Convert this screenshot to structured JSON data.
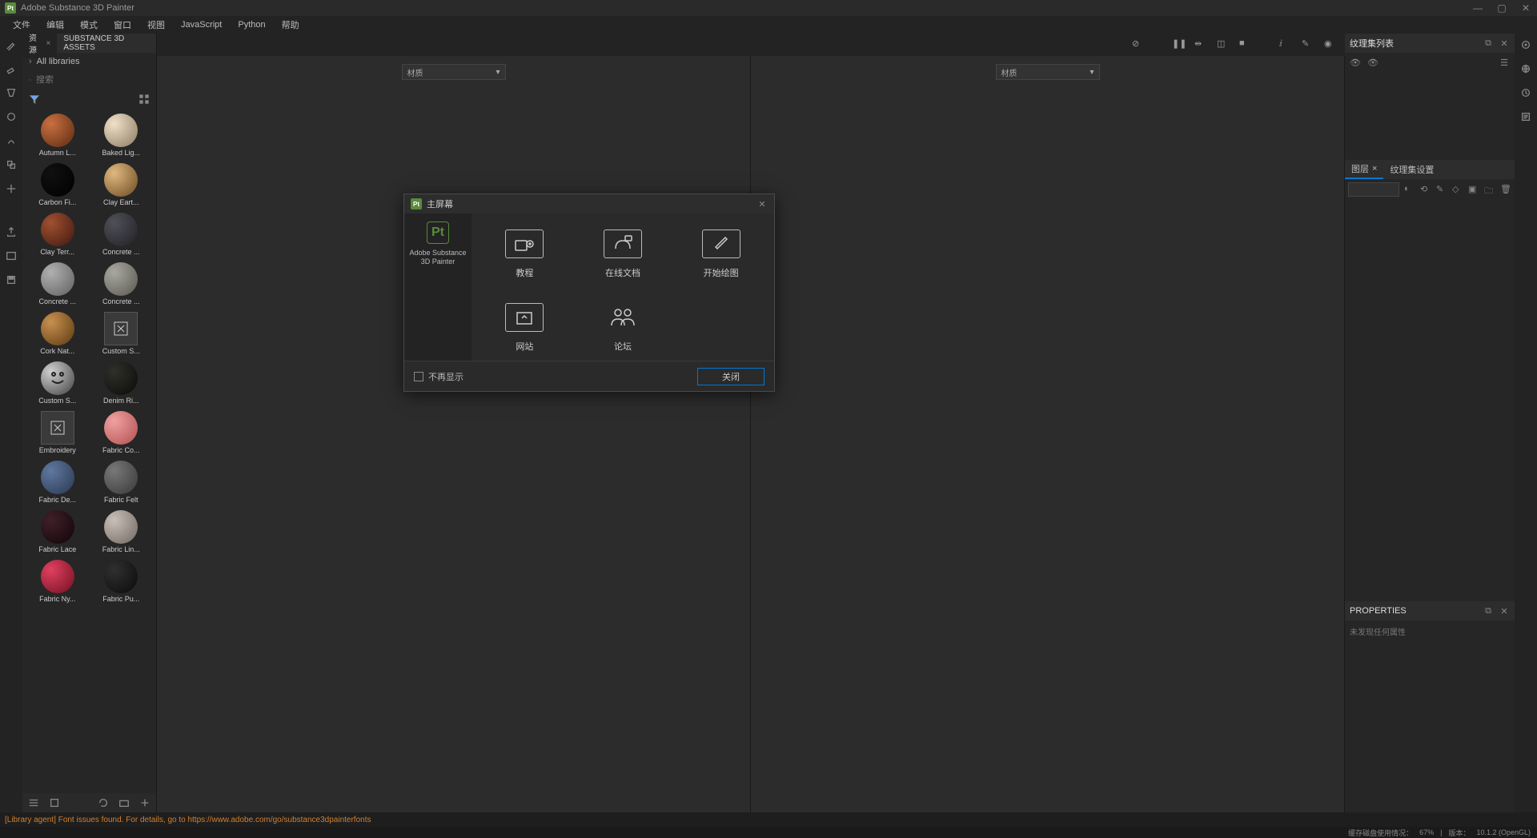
{
  "titlebar": {
    "title": "Adobe Substance 3D Painter",
    "pt": "Pt"
  },
  "menu": [
    "文件",
    "编辑",
    "模式",
    "窗口",
    "视图",
    "JavaScript",
    "Python",
    "帮助"
  ],
  "assets": {
    "tab1": "资源",
    "tab2": "SUBSTANCE 3D ASSETS",
    "breadcrumb": "All libraries",
    "search_placeholder": "搜索",
    "items": [
      {
        "label": "Autumn L...",
        "hl": "#c97040",
        "lo": "#5a2a10",
        "leaf": true
      },
      {
        "label": "Baked Lig...",
        "hl": "#f0e0c8",
        "lo": "#8a7a60"
      },
      {
        "label": "Carbon Fi...",
        "hl": "#101010",
        "lo": "#000"
      },
      {
        "label": "Clay Eart...",
        "hl": "#e0b880",
        "lo": "#6a4a20"
      },
      {
        "label": "Clay Terr...",
        "hl": "#a05030",
        "lo": "#401810"
      },
      {
        "label": "Concrete ...",
        "hl": "#505058",
        "lo": "#202024"
      },
      {
        "label": "Concrete ...",
        "hl": "#b0b0b0",
        "lo": "#606060"
      },
      {
        "label": "Concrete ...",
        "hl": "#a8a8a0",
        "lo": "#585850"
      },
      {
        "label": "Cork Nat...",
        "hl": "#c89050",
        "lo": "#5a3a10"
      },
      {
        "label": "Custom S...",
        "sq": true
      },
      {
        "label": "Custom S...",
        "face": true
      },
      {
        "label": "Denim Ri...",
        "hl": "#30302a",
        "lo": "#0a0a08",
        "ring": true
      },
      {
        "label": "Embroidery",
        "sq": true,
        "emb": true
      },
      {
        "label": "Fabric Co...",
        "hl": "#f0a0a0",
        "lo": "#b05050"
      },
      {
        "label": "Fabric De...",
        "hl": "#6078a0",
        "lo": "#283850"
      },
      {
        "label": "Fabric Felt",
        "hl": "#787878",
        "lo": "#383838"
      },
      {
        "label": "Fabric Lace",
        "hl": "#402028",
        "lo": "#100408"
      },
      {
        "label": "Fabric Lin...",
        "hl": "#c8c0b8",
        "lo": "#706860"
      },
      {
        "label": "Fabric Ny...",
        "hl": "#e04060",
        "lo": "#701020"
      },
      {
        "label": "Fabric Pu...",
        "hl": "#303030",
        "lo": "#0a0a0a"
      }
    ]
  },
  "viewport": {
    "material": "材质"
  },
  "right": {
    "textureList": "纹理集列表",
    "layers": "图层",
    "textureSettings": "纹理集设置",
    "properties": "PROPERTIES",
    "noProps": "未发现任何属性"
  },
  "modal": {
    "title": "主屏幕",
    "pt": "Pt",
    "leftLabel": "Adobe Substance 3D Painter",
    "tiles": [
      {
        "key": "tutorial",
        "label": "教程"
      },
      {
        "key": "docs",
        "label": "在线文档"
      },
      {
        "key": "paint",
        "label": "开始绘图"
      },
      {
        "key": "website",
        "label": "网站"
      },
      {
        "key": "forum",
        "label": "论坛"
      }
    ],
    "dontShow": "不再显示",
    "close": "关闭"
  },
  "warning": "[Library agent] Font issues found. For details, go to https://www.adobe.com/go/substance3dpainterfonts",
  "status": {
    "disk": "缓存磁盘使用情况：",
    "pct": "67%",
    "sep": "|",
    "ver": "版本：",
    "version": "10.1.2 (OpenGL)"
  }
}
